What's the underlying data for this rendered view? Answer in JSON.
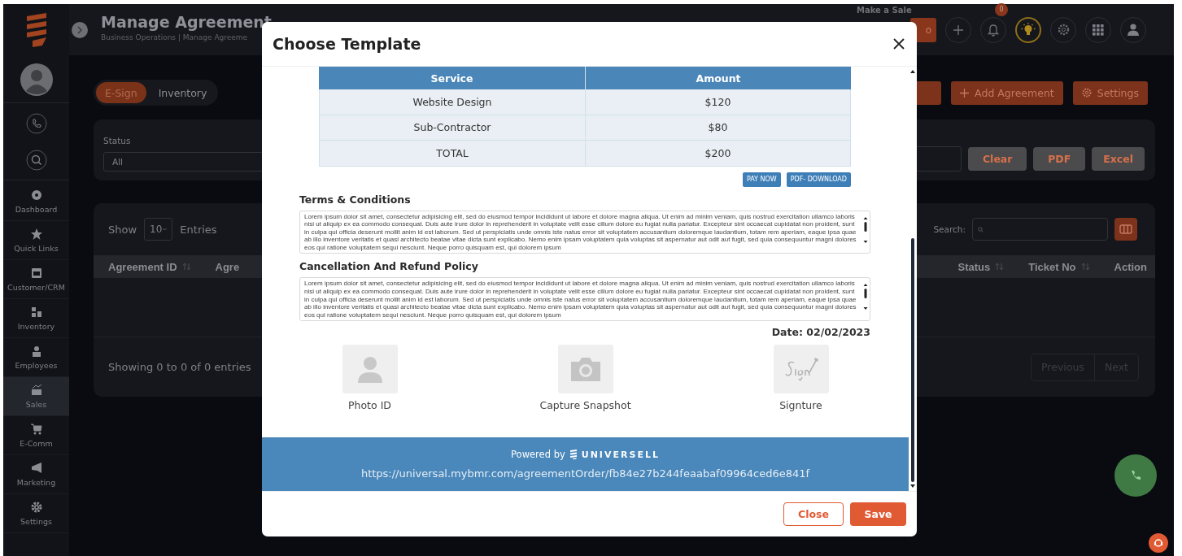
{
  "sidebar": {
    "items": [
      {
        "label": "Dashboard",
        "selected": false
      },
      {
        "label": "Quick Links",
        "selected": false
      },
      {
        "label": "Customer/CRM",
        "selected": false
      },
      {
        "label": "Inventory",
        "selected": false
      },
      {
        "label": "Employees",
        "selected": false
      },
      {
        "label": "Sales",
        "selected": true
      },
      {
        "label": "E-Comm",
        "selected": false
      },
      {
        "label": "Marketing",
        "selected": false
      },
      {
        "label": "Settings",
        "selected": false
      }
    ]
  },
  "header": {
    "title": "Manage Agreement",
    "breadcrumb": "Business Operations | Manage Agreeme",
    "make_a_sale": "Make a Sale",
    "go_button": "o",
    "notification_count": "0"
  },
  "tabs": [
    {
      "label": "E-Sign",
      "selected": true
    },
    {
      "label": "Inventory",
      "selected": false
    }
  ],
  "actions": [
    {
      "label": "Add Agreement",
      "kind": "add"
    },
    {
      "label": "Settings",
      "kind": "settings"
    }
  ],
  "filter": {
    "status_label": "Status",
    "status_value": "All",
    "buttons": [
      "Clear",
      "PDF",
      "Excel"
    ]
  },
  "table": {
    "show_label": "Show",
    "page_size": "10",
    "entries_label": "Entries",
    "search_label": "Search:",
    "columns": [
      {
        "label": "Agreement ID",
        "sortable": true
      },
      {
        "label": "Agre",
        "sortable": false
      },
      {
        "label": "Status",
        "sortable": true
      },
      {
        "label": "Ticket No",
        "sortable": true
      },
      {
        "label": "Action",
        "sortable": false
      }
    ],
    "info": "Showing 0 to 0 of 0 entries",
    "pagination": [
      "Previous",
      "Next"
    ]
  },
  "modal": {
    "title": "Choose Template",
    "invoice": {
      "columns": [
        "Service",
        "Amount"
      ],
      "rows": [
        [
          "Website Design",
          "$120"
        ],
        [
          "Sub-Contractor",
          "$80"
        ],
        [
          "TOTAL",
          "$200"
        ]
      ],
      "buttons": [
        "PAY NOW",
        "PDF- DOWNLOAD"
      ]
    },
    "sections": [
      {
        "heading": "Terms & Conditions",
        "text": "Lorem ipsum dolor sit amet, consectetur adipisicing elit, sed do eiusmod tempor incididunt ut labore et dolore magna aliqua. Ut enim ad minim veniam, quis nostrud exercitation ullamco laboris nisi ut aliquip ex ea commodo consequat. Duis aute irure dolor in reprehenderit in voluptate velit esse cillum dolore eu fugiat nulla pariatur. Excepteur sint occaecat cupidatat non proident, sunt in culpa qui officia deserunt mollit anim id est laborum. Sed ut perspiciatis unde omnis iste natus error sit voluptatem accusantium doloremque laudantium, totam rem aperiam, eaque ipsa quae ab illo inventore veritatis et quasi architecto beatae vitae dicta sunt explicabo. Nemo enim ipsam voluptatem quia voluptas sit aspernatur aut odit aut fugit, sed quia consequuntur magni dolores eos qui ratione voluptatem sequi nesciunt. Neque porro quisquam est, qui dolorem ipsum"
      },
      {
        "heading": "Cancellation And Refund Policy",
        "text": "Lorem ipsum dolor sit amet, consectetur adipisicing elit, sed do eiusmod tempor incididunt ut labore et dolore magna aliqua. Ut enim ad minim veniam, quis nostrud exercitation ullamco laboris nisi ut aliquip ex ea commodo consequat. Duis aute irure dolor in reprehenderit in voluptate velit esse cillum dolore eu fugiat nulla pariatur. Excepteur sint occaecat cupidatat non proident, sunt in culpa qui officia deserunt mollit anim id est laborum. Sed ut perspiciatis unde omnis iste natus error sit voluptatem accusantium doloremque laudantium, totam rem aperiam, eaque ipsa quae ab illo inventore veritatis et quasi architecto beatae vitae dicta sunt explicabo. Nemo enim ipsam voluptatem quia voluptas sit aspernatur aut odit aut fugit, sed quia consequuntur magni dolores eos qui ratione voluptatem sequi nesciunt. Neque porro quisquam est, qui dolorem ipsum"
      }
    ],
    "date": "Date: 02/02/2023",
    "attachments": [
      "Photo ID",
      "Capture Snapshot",
      "Signture"
    ],
    "footer": {
      "powered_by": "Powered by",
      "brand": "UNIVERSELL",
      "url": "https://universal.mybmr.com/agreementOrder/fb84e27b244feaabaf09964ced6e841f"
    },
    "buttons": [
      {
        "label": "Close",
        "kind": "secondary"
      },
      {
        "label": "Save",
        "kind": "primary"
      }
    ]
  }
}
